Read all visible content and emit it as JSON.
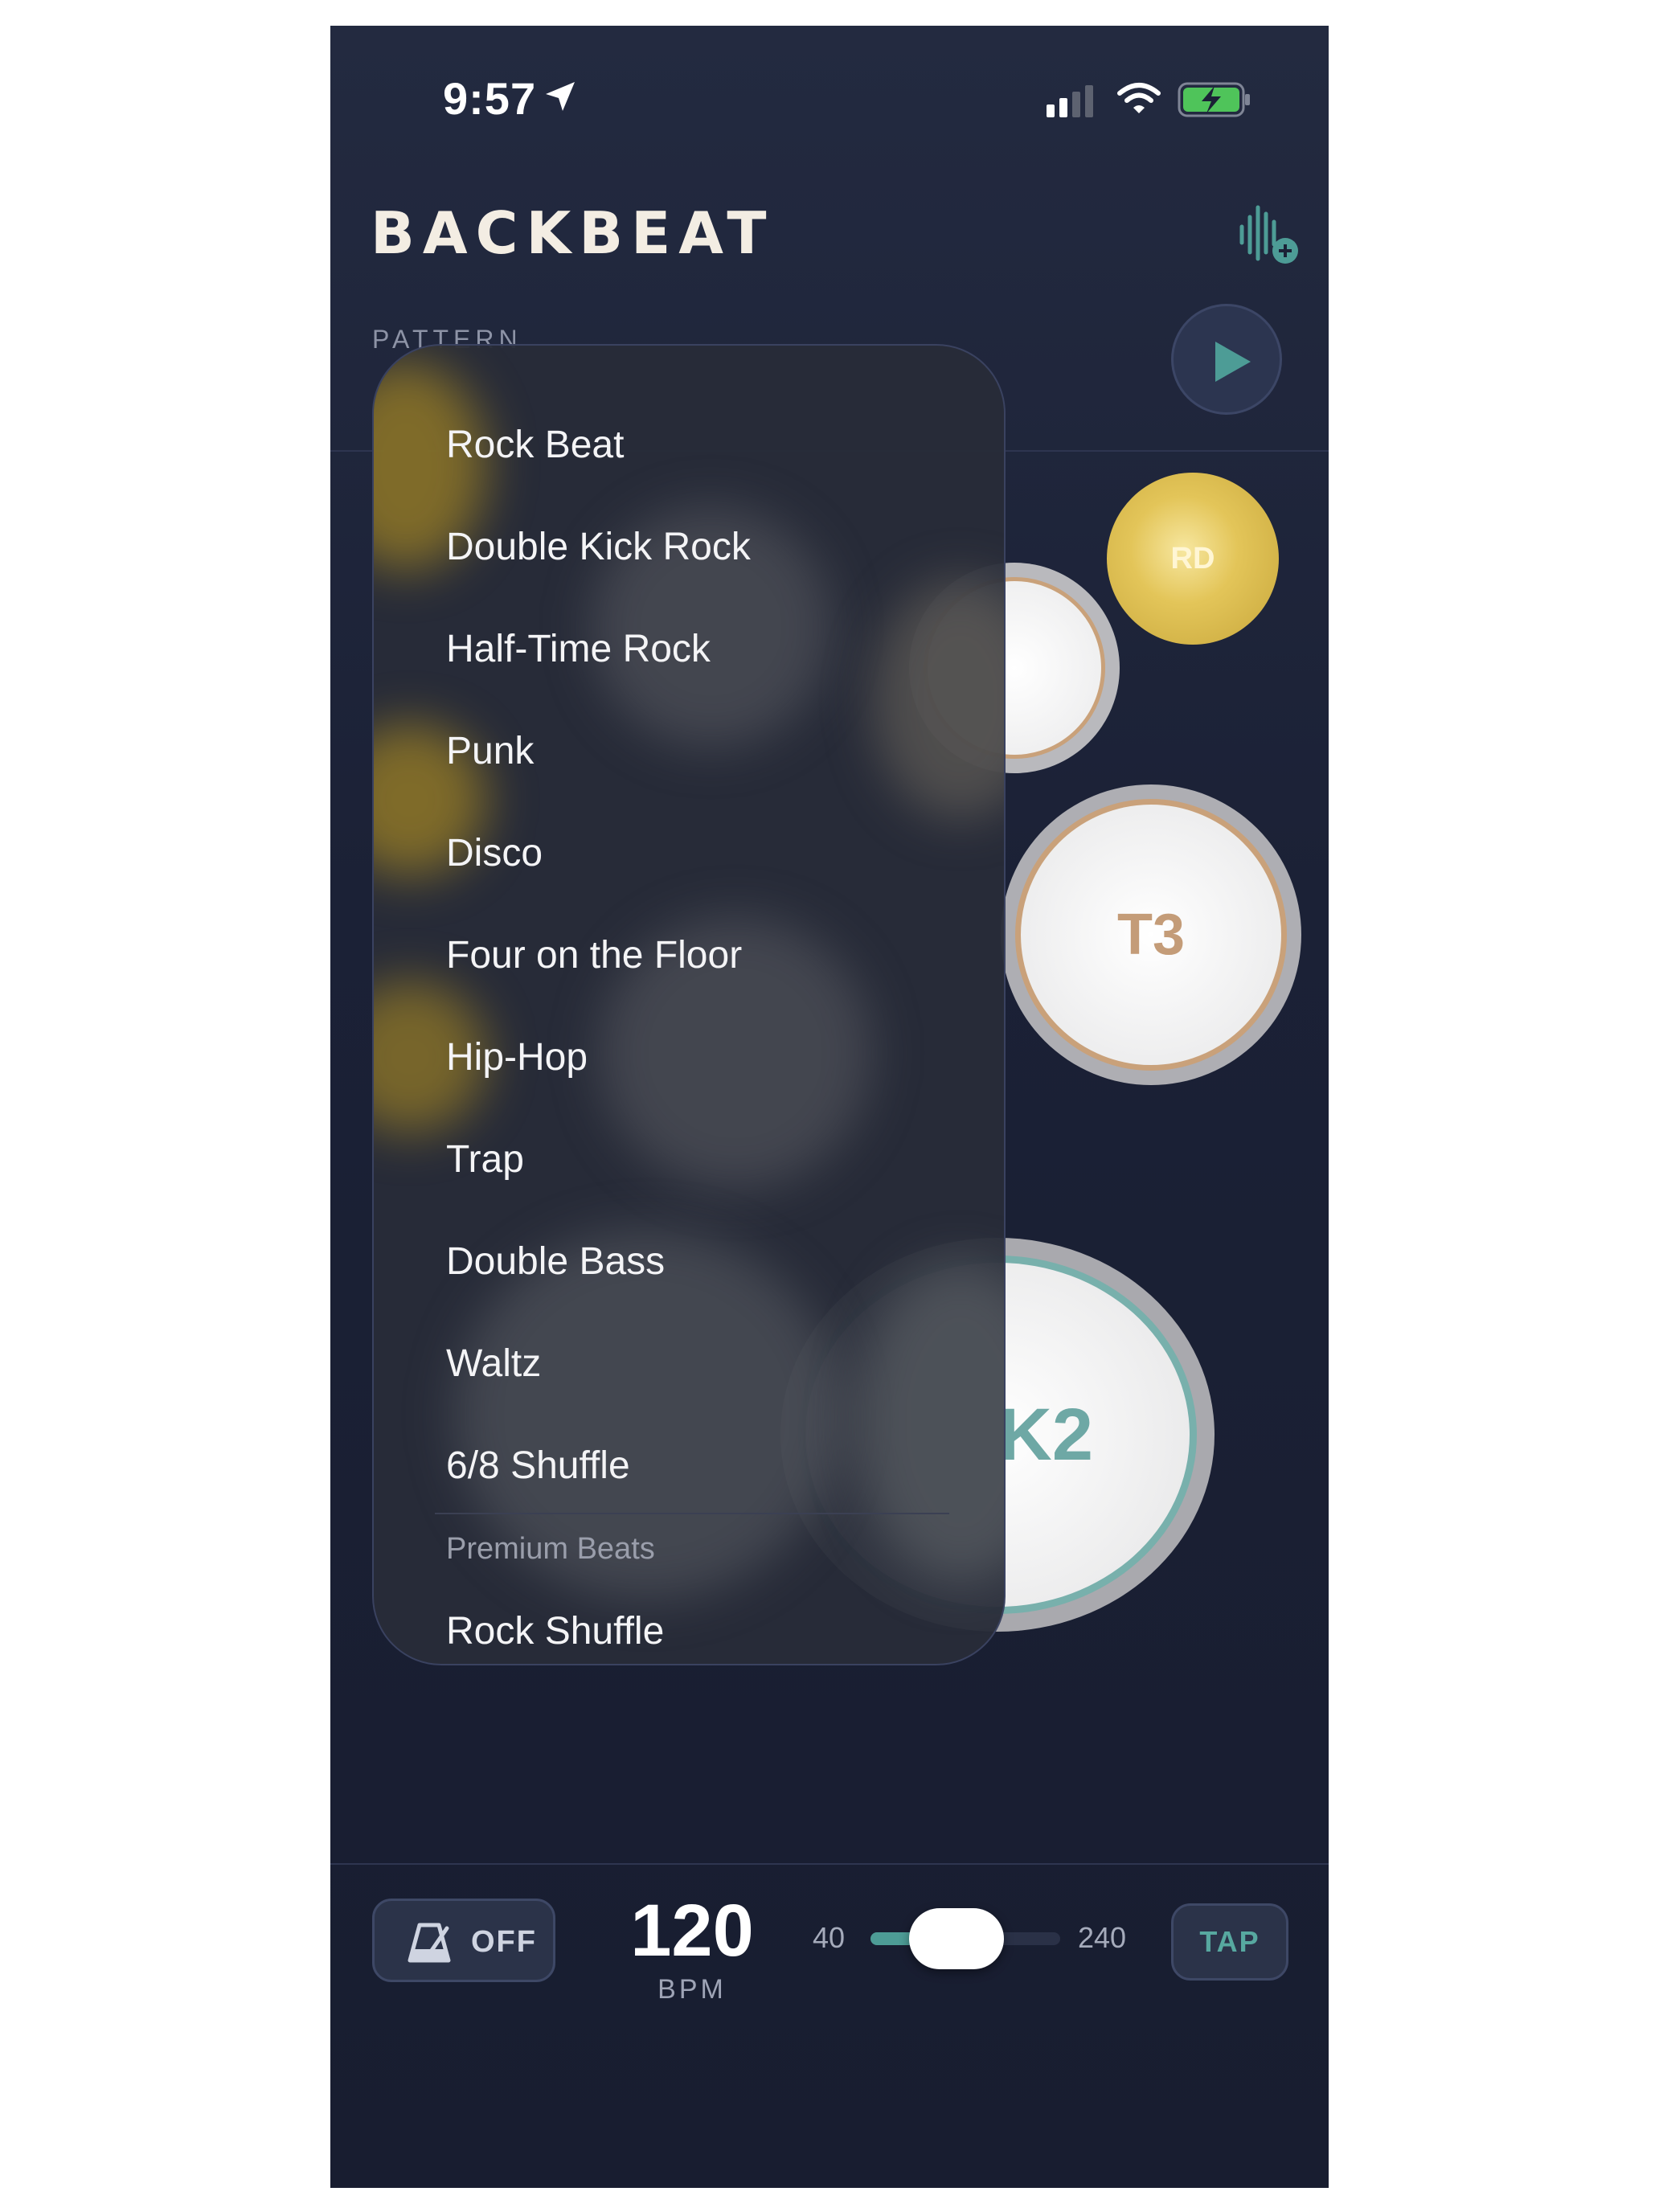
{
  "status_bar": {
    "time": "9:57"
  },
  "header": {
    "brand": "BACKBEAT",
    "pattern_label": "PATTERN"
  },
  "drums": {
    "ride": "RD",
    "tom3": "T3",
    "kick2": "K2"
  },
  "pattern_menu": {
    "items": [
      "Rock Beat",
      "Double Kick Rock",
      "Half-Time Rock",
      "Punk",
      "Disco",
      "Four on the Floor",
      "Hip-Hop",
      "Trap",
      "Double Bass",
      "Waltz",
      "6/8 Shuffle"
    ],
    "premium_section": "Premium Beats",
    "premium_items": [
      "Rock Shuffle"
    ]
  },
  "controls": {
    "metronome_label": "OFF",
    "bpm_value": "120",
    "bpm_label": "BPM",
    "bpm_min": "40",
    "bpm_max": "240",
    "bpm_current": 120,
    "tap_label": "TAP"
  },
  "colors": {
    "accent_teal": "#57a8a0",
    "ride_gold": "#e3c559",
    "tom_rim": "#c9a17a",
    "background": "#1b2136"
  }
}
